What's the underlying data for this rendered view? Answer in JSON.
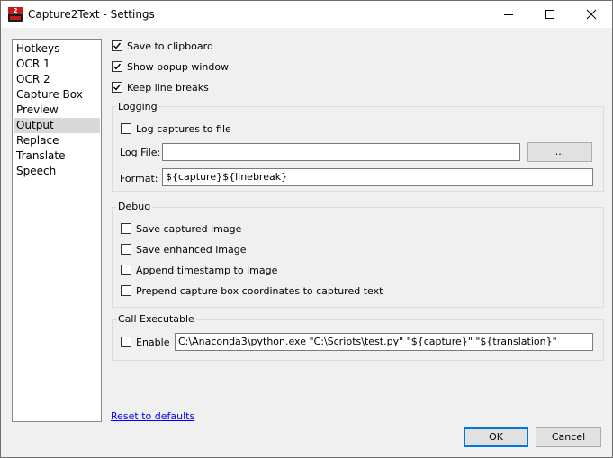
{
  "window": {
    "title": "Capture2Text - Settings"
  },
  "sidebar": {
    "items": [
      "Hotkeys",
      "OCR 1",
      "OCR 2",
      "Capture Box",
      "Preview",
      "Output",
      "Replace",
      "Translate",
      "Speech"
    ],
    "selected": "Output"
  },
  "options": {
    "save_clipboard": {
      "label": "Save to clipboard",
      "checked": true
    },
    "show_popup": {
      "label": "Show popup window",
      "checked": true
    },
    "keep_line_breaks": {
      "label": "Keep line breaks",
      "checked": true
    }
  },
  "logging": {
    "title": "Logging",
    "log_captures": {
      "label": "Log captures to file",
      "checked": false
    },
    "log_file_label": "Log File:",
    "log_file_value": "",
    "browse_label": "...",
    "format_label": "Format:",
    "format_value": "${capture}${linebreak}"
  },
  "debug": {
    "title": "Debug",
    "save_captured": {
      "label": "Save captured image",
      "checked": false
    },
    "save_enhanced": {
      "label": "Save enhanced image",
      "checked": false
    },
    "append_timestamp": {
      "label": "Append timestamp to image",
      "checked": false
    },
    "prepend_coords": {
      "label": "Prepend capture box coordinates to captured text",
      "checked": false
    }
  },
  "call_executable": {
    "title": "Call Executable",
    "enable": {
      "label": "Enable",
      "checked": false
    },
    "command": "C:\\Anaconda3\\python.exe \"C:\\Scripts\\test.py\" \"${capture}\" \"${translation}\""
  },
  "footer": {
    "reset_label": "Reset to defaults",
    "ok_label": "OK",
    "cancel_label": "Cancel"
  },
  "colors": {
    "accent": "#0078d7",
    "link": "#0000ee",
    "selection": "#d9d9d9"
  }
}
